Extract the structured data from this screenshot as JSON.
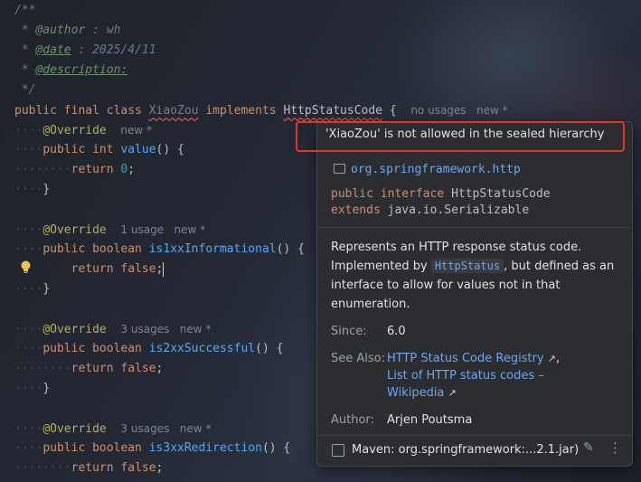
{
  "editor": {
    "lines": [
      {
        "t": [
          {
            "c": "cm",
            "s": "/**"
          }
        ]
      },
      {
        "t": [
          {
            "c": "cm",
            "s": " * "
          },
          {
            "c": "cmtag",
            "s": "@author"
          },
          {
            "c": "cm",
            "s": " : wh"
          }
        ]
      },
      {
        "t": [
          {
            "c": "cm",
            "s": " * "
          },
          {
            "c": "cmtag-u",
            "s": "@date"
          },
          {
            "c": "cm",
            "s": " : 2025/4/11"
          }
        ]
      },
      {
        "t": [
          {
            "c": "cm",
            "s": " * "
          },
          {
            "c": "cmtag-u",
            "s": "@description:"
          }
        ]
      },
      {
        "t": [
          {
            "c": "cm",
            "s": " */"
          }
        ]
      },
      {
        "t": [
          {
            "c": "kw",
            "s": "public final class "
          },
          {
            "c": "cls-unused",
            "s": "XiaoZou"
          },
          {
            "c": "kw",
            "s": " implements "
          },
          {
            "c": "cls",
            "s": "HttpStatusCode"
          },
          {
            "c": "txt",
            "s": " {  "
          },
          {
            "c": "hint",
            "s": "no usages   new *"
          }
        ]
      },
      {
        "t": [
          {
            "c": "ws",
            "s": "····"
          },
          {
            "c": "ann",
            "s": "@Override"
          },
          {
            "c": "txt",
            "s": "  "
          },
          {
            "c": "hint",
            "s": "new *"
          }
        ]
      },
      {
        "t": [
          {
            "c": "ws",
            "s": "····"
          },
          {
            "c": "kw",
            "s": "public int "
          },
          {
            "c": "fn",
            "s": "value"
          },
          {
            "c": "txt",
            "s": "() {"
          }
        ]
      },
      {
        "t": [
          {
            "c": "ws",
            "s": "········"
          },
          {
            "c": "kw",
            "s": "return "
          },
          {
            "c": "num",
            "s": "0"
          },
          {
            "c": "txt",
            "s": ";"
          }
        ]
      },
      {
        "t": [
          {
            "c": "ws",
            "s": "····"
          },
          {
            "c": "txt",
            "s": "}"
          }
        ]
      },
      {
        "t": []
      },
      {
        "t": [
          {
            "c": "ws",
            "s": "····"
          },
          {
            "c": "ann",
            "s": "@Override"
          },
          {
            "c": "txt",
            "s": "  "
          },
          {
            "c": "hint",
            "s": "1 usage   new *"
          }
        ]
      },
      {
        "t": [
          {
            "c": "ws",
            "s": "····"
          },
          {
            "c": "kw",
            "s": "public boolean "
          },
          {
            "c": "fn",
            "s": "is1xxInformational"
          },
          {
            "c": "txt",
            "s": "() {"
          }
        ]
      },
      {
        "t": [
          {
            "c": "ws",
            "s": "        "
          },
          {
            "c": "kw",
            "s": "return false"
          },
          {
            "c": "txt",
            "s": ";"
          },
          {
            "c": "caret",
            "s": ""
          }
        ]
      },
      {
        "t": [
          {
            "c": "ws",
            "s": "····"
          },
          {
            "c": "txt",
            "s": "}"
          }
        ]
      },
      {
        "t": []
      },
      {
        "t": [
          {
            "c": "ws",
            "s": "····"
          },
          {
            "c": "ann",
            "s": "@Override"
          },
          {
            "c": "txt",
            "s": "  "
          },
          {
            "c": "hint",
            "s": "3 usages   new *"
          }
        ]
      },
      {
        "t": [
          {
            "c": "ws",
            "s": "····"
          },
          {
            "c": "kw",
            "s": "public boolean "
          },
          {
            "c": "fn",
            "s": "is2xxSuccessful"
          },
          {
            "c": "txt",
            "s": "() {"
          }
        ]
      },
      {
        "t": [
          {
            "c": "ws",
            "s": "········"
          },
          {
            "c": "kw",
            "s": "return false"
          },
          {
            "c": "txt",
            "s": ";"
          }
        ]
      },
      {
        "t": [
          {
            "c": "ws",
            "s": "····"
          },
          {
            "c": "txt",
            "s": "}"
          }
        ]
      },
      {
        "t": []
      },
      {
        "t": [
          {
            "c": "ws",
            "s": "····"
          },
          {
            "c": "ann",
            "s": "@Override"
          },
          {
            "c": "txt",
            "s": "  "
          },
          {
            "c": "hint",
            "s": "3 usages   new *"
          }
        ]
      },
      {
        "t": [
          {
            "c": "ws",
            "s": "····"
          },
          {
            "c": "kw",
            "s": "public boolean "
          },
          {
            "c": "fn",
            "s": "is3xxRedirection"
          },
          {
            "c": "txt",
            "s": "() {"
          }
        ]
      },
      {
        "t": [
          {
            "c": "ws",
            "s": "········"
          },
          {
            "c": "kw",
            "s": "return false"
          },
          {
            "c": "txt",
            "s": ";"
          }
        ]
      }
    ],
    "bulb_icon": "lightbulb-icon"
  },
  "popup": {
    "error": "'XiaoZou' is not allowed in the sealed hierarchy",
    "package": "org.springframework.http",
    "signature": {
      "line1_kw": "public interface ",
      "line1_name": "HttpStatusCode",
      "line2_kw": "extends ",
      "line2_name": "java.io.Serializable"
    },
    "description": {
      "part1": "Represents an HTTP response status code. Implemented by ",
      "chip": "HttpStatus",
      "part2": ", but defined as an interface to allow for values not in that enumeration."
    },
    "since_label": "Since:",
    "since_value": "6.0",
    "see_also_label": "See Also:",
    "see_also_links": [
      "HTTP Status Code Registry",
      "List of HTTP status codes –",
      "Wikipedia"
    ],
    "see_also_sep": ",",
    "author_label": "Author:",
    "author_value": "Arjen Poutsma",
    "footer": "Maven: org.springframework:...2.1.jar)",
    "accent": "#6ea6f0",
    "error_border": "#e0352b"
  }
}
